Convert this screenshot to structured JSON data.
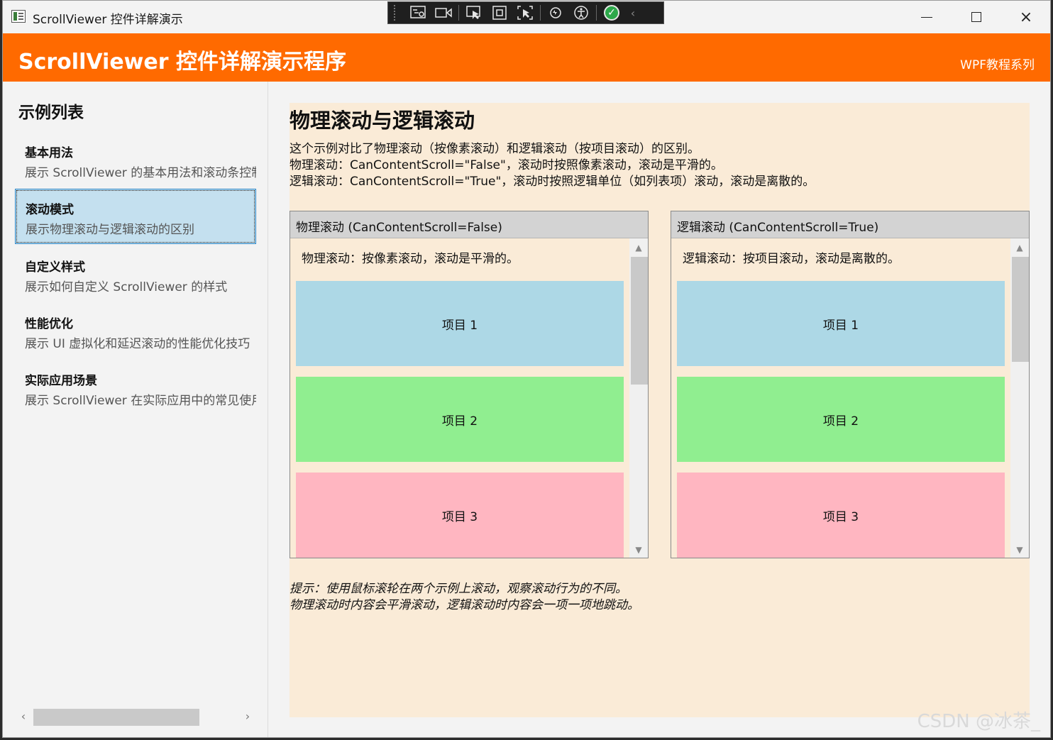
{
  "window": {
    "title": "ScrollViewer 控件详解演示",
    "controls": {
      "minimize": "minimize",
      "maximize": "maximize",
      "close": "×"
    }
  },
  "debug_toolbar": {
    "buttons": [
      "live-visual-tree-icon",
      "record-icon",
      "select-element-icon",
      "display-layout-adorners-icon",
      "track-focus-icon",
      "hot-reload-icon",
      "accessibility-icon",
      "check-icon",
      "collapse-icon"
    ]
  },
  "header": {
    "title": "ScrollViewer 控件详解演示程序",
    "subtitle": "WPF教程系列",
    "color": "#ff6a00"
  },
  "sidebar": {
    "heading": "示例列表",
    "items": [
      {
        "title": "基本用法",
        "desc": "展示 ScrollViewer 的基本用法和滚动条控制",
        "selected": false
      },
      {
        "title": "滚动模式",
        "desc": "展示物理滚动与逻辑滚动的区别",
        "selected": true
      },
      {
        "title": "自定义样式",
        "desc": "展示如何自定义 ScrollViewer 的样式",
        "selected": false
      },
      {
        "title": "性能优化",
        "desc": "展示 UI 虚拟化和延迟滚动的性能优化技巧",
        "selected": false
      },
      {
        "title": "实际应用场景",
        "desc": "展示 ScrollViewer 在实际应用中的常见使用",
        "selected": false
      }
    ],
    "scroll": {
      "left": "‹",
      "right": "›"
    }
  },
  "main": {
    "title": "物理滚动与逻辑滚动",
    "intro": [
      "这个示例对比了物理滚动（按像素滚动）和逻辑滚动（按项目滚动）的区别。",
      "物理滚动：CanContentScroll=\"False\"，滚动时按照像素滚动，滚动是平滑的。",
      "逻辑滚动：CanContentScroll=\"True\"，滚动时按照逻辑单位（如列表项）滚动，滚动是离散的。"
    ],
    "physical": {
      "header": "物理滚动 (CanContentScroll=False)",
      "note": "物理滚动：按像素滚动，滚动是平滑的。",
      "items": [
        "项目 1",
        "项目 2",
        "项目 3"
      ]
    },
    "logical": {
      "header": "逻辑滚动 (CanContentScroll=True)",
      "note": "逻辑滚动：按项目滚动，滚动是离散的。",
      "items": [
        "项目 1",
        "项目 2",
        "项目 3"
      ]
    },
    "tip": [
      "提示：使用鼠标滚轮在两个示例上滚动，观察滚动行为的不同。",
      "物理滚动时内容会平滑滚动，逻辑滚动时内容会一项一项地跳动。"
    ],
    "colors": {
      "background": "#faebd7",
      "item1": "#add8e6",
      "item2": "#90ee90",
      "item3": "#ffb6c1"
    }
  },
  "watermark": "CSDN @冰茶_"
}
